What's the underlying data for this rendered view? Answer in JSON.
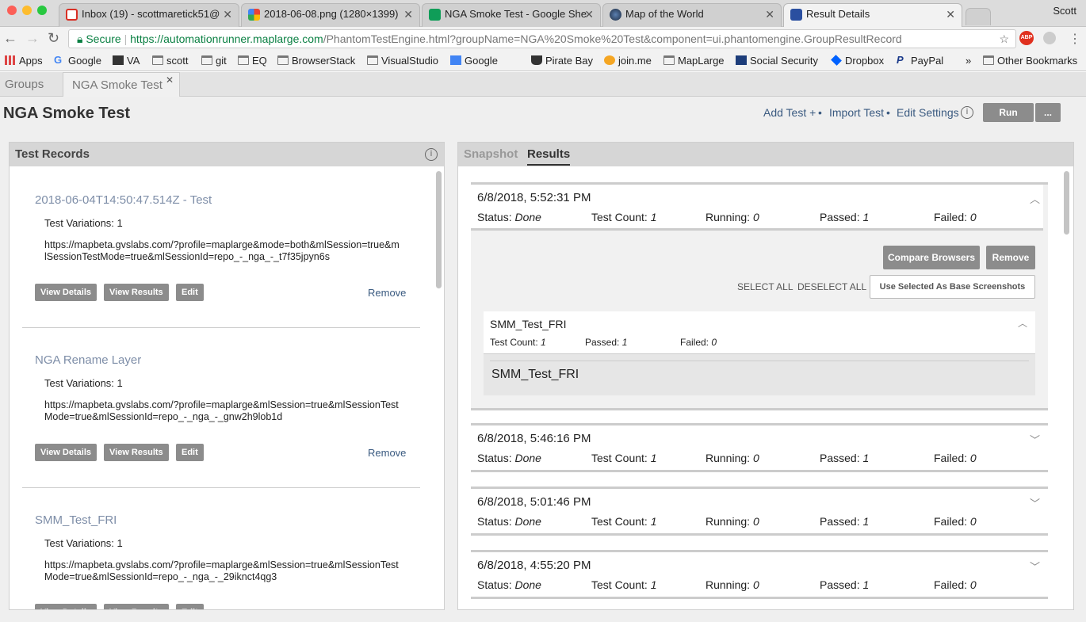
{
  "browser": {
    "user": "Scott",
    "tabs": [
      {
        "title": "Inbox (19) - scottmaretick51@",
        "icon_color": "#d93025"
      },
      {
        "title": "2018-06-08.png (1280×1399)",
        "icon_color": "#4285f4"
      },
      {
        "title": "NGA Smoke Test - Google She",
        "icon_color": "#0f9d58"
      },
      {
        "title": "Map of the World",
        "icon_color": "#2b2b2b"
      },
      {
        "title": "Result Details",
        "icon_color": "#2a4fa0"
      }
    ],
    "secure_label": "Secure",
    "url_host": "https://automationrunner.maplarge.com",
    "url_path": "/PhantomTestEngine.html?groupName=NGA%20Smoke%20Test&component=ui.phantomengine.GroupResultRecord",
    "bookmarks": [
      "Apps",
      "Google",
      "VA",
      "scott",
      "git",
      "EQ",
      "BrowserStack",
      "VisualStudio",
      "Google",
      "Pirate Bay",
      "join.me",
      "MapLarge",
      "Social Security",
      "Dropbox",
      "PayPal"
    ],
    "bookmarks_more": "»",
    "other_bookmarks": "Other Bookmarks"
  },
  "app": {
    "tabs": [
      "Groups",
      "NGA Smoke Test"
    ],
    "title": "NGA Smoke Test",
    "add_test": "Add Test +",
    "import_test": "Import Test",
    "edit_settings": "Edit Settings",
    "run": "Run",
    "more": "...",
    "sep": "•"
  },
  "left": {
    "header": "Test Records",
    "records": [
      {
        "title": "2018-06-04T14:50:47.514Z - Test",
        "variations": "Test Variations: 1",
        "url": "https://mapbeta.gvslabs.com/?profile=maplarge&mode=both&mlSession=true&mlSessionTestMode=true&mlSessionId=repo_-_nga_-_t7f35jpyn6s"
      },
      {
        "title": "NGA Rename Layer",
        "variations": "Test Variations: 1",
        "url": "https://mapbeta.gvslabs.com/?profile=maplarge&mlSession=true&mlSessionTestMode=true&mlSessionId=repo_-_nga_-_gnw2h9lob1d"
      },
      {
        "title": "SMM_Test_FRI",
        "variations": "Test Variations: 1",
        "url": "https://mapbeta.gvslabs.com/?profile=maplarge&mlSession=true&mlSessionTestMode=true&mlSessionId=repo_-_nga_-_29iknct4qg3"
      }
    ],
    "view_details": "View Details",
    "view_results": "View Results",
    "edit": "Edit",
    "remove": "Remove"
  },
  "right": {
    "tabs": [
      "Snapshot",
      "Results"
    ],
    "labels": {
      "status": "Status:",
      "count": "Test Count:",
      "running": "Running:",
      "passed": "Passed:",
      "failed": "Failed:"
    },
    "compare": "Compare Browsers",
    "remove": "Remove",
    "select_all": "SELECT ALL",
    "deselect_all": "DESELECT ALL",
    "use_selected": "Use Selected As Base Screenshots",
    "sub": {
      "name": "SMM_Test_FRI",
      "count_label": "Test Count:",
      "count": "1",
      "passed_label": "Passed:",
      "passed": "1",
      "failed_label": "Failed:",
      "failed": "0",
      "body": "SMM_Test_FRI"
    },
    "results": [
      {
        "date": "6/8/2018, 5:52:31 PM",
        "status": "Done",
        "count": "1",
        "running": "0",
        "passed": "1",
        "failed": "0"
      },
      {
        "date": "6/8/2018, 5:46:16 PM",
        "status": "Done",
        "count": "1",
        "running": "0",
        "passed": "1",
        "failed": "0"
      },
      {
        "date": "6/8/2018, 5:01:46 PM",
        "status": "Done",
        "count": "1",
        "running": "0",
        "passed": "1",
        "failed": "0"
      },
      {
        "date": "6/8/2018, 4:55:20 PM",
        "status": "Done",
        "count": "1",
        "running": "0",
        "passed": "1",
        "failed": "0"
      }
    ]
  }
}
